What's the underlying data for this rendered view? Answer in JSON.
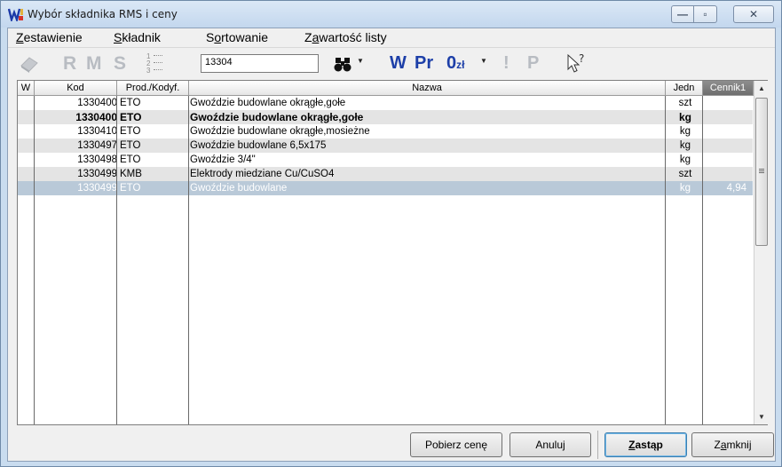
{
  "window": {
    "title": "Wybór składnika  RMS i ceny",
    "icon": "app-logo-icon",
    "controls": {
      "minimize": "—",
      "maximize": "▫",
      "close": "✕"
    }
  },
  "menu": [
    {
      "pre": "",
      "key": "Z",
      "post": "estawienie"
    },
    {
      "pre": "",
      "key": "S",
      "post": "kładnik"
    },
    {
      "pre": "S",
      "key": "o",
      "post": "rtowanie"
    },
    {
      "pre": "Z",
      "key": "a",
      "post": "wartość listy"
    }
  ],
  "toolbar": {
    "r": "R",
    "m": "M",
    "s": "S",
    "numbering": "1\n2\n3",
    "search_value": "13304",
    "w": "W",
    "pr": "Pr",
    "zero": "0",
    "zl": "zł",
    "excl": "!",
    "p": "P",
    "icons": [
      "eraser-icon",
      "numbered-list-icon",
      "binoculars-icon",
      "dropdown-arrow-icon",
      "help-cursor-icon"
    ]
  },
  "grid": {
    "columns": [
      "W",
      "Kod",
      "Prod./Kodyf.",
      "Nazwa",
      "Jedn",
      "Cennik1"
    ],
    "rows": [
      {
        "code": "1330400",
        "prod": "ETO",
        "name": "Gwoździe budowlane okrągłe,gołe",
        "unit": "szt",
        "price": ""
      },
      {
        "code": "1330400",
        "prod": "ETO",
        "name": "Gwoździe budowlane okrągłe,gołe",
        "unit": "kg",
        "price": ""
      },
      {
        "code": "1330410",
        "prod": "ETO",
        "name": "Gwoździe budowlane okrągłe,mosieżne",
        "unit": "kg",
        "price": ""
      },
      {
        "code": "1330497",
        "prod": "ETO",
        "name": "Gwoździe budowlane 6,5x175",
        "unit": "kg",
        "price": ""
      },
      {
        "code": "1330498",
        "prod": "ETO",
        "name": "Gwoździe 3/4\"",
        "unit": "kg",
        "price": ""
      },
      {
        "code": "1330499",
        "prod": "KMB",
        "name": "Elektrody miedziane Cu/CuSO4",
        "unit": "szt",
        "price": ""
      },
      {
        "code": "1330499",
        "prod": "ETO",
        "name": "Gwoździe budowlane",
        "unit": "kg",
        "price": "4,94"
      }
    ],
    "bold_row": 1,
    "selected_row": 6
  },
  "buttons": {
    "fetch_price": "Pobierz cenę",
    "cancel": "Anuluj",
    "replace": {
      "key": "Z",
      "post": "astąp"
    },
    "close": {
      "pre": "Z",
      "key": "a",
      "post": "mknij"
    }
  },
  "colors": {
    "selection": "#b9c9d8",
    "alt_row": "#e4e4e4",
    "toolbar_blue": "#1d3fa8",
    "disabled": "#b8bcc2"
  }
}
